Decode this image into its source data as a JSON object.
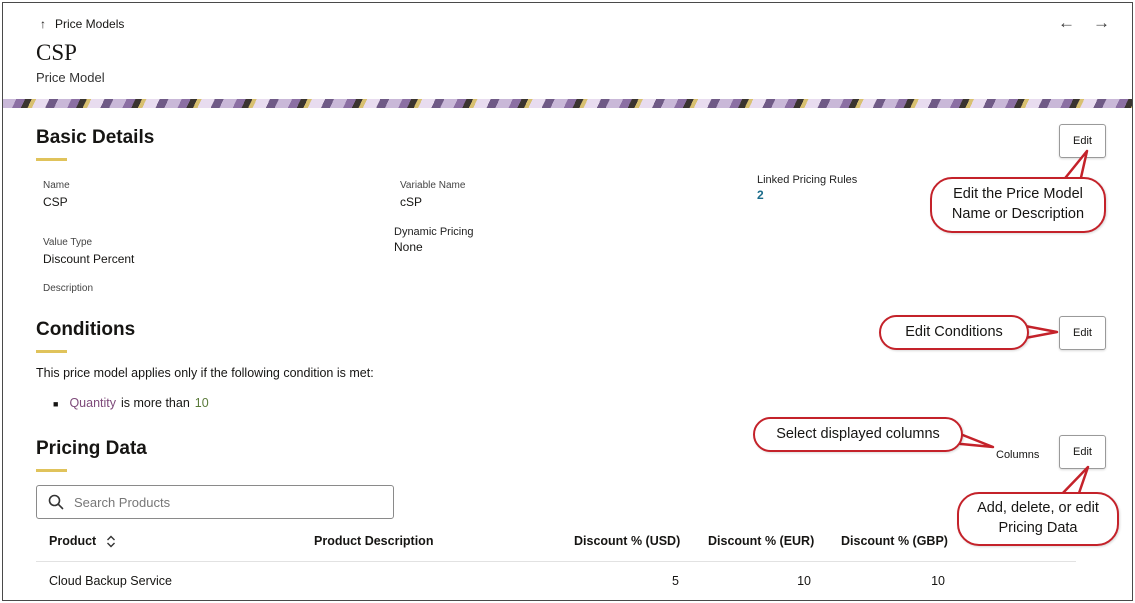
{
  "header": {
    "breadcrumb": "Price Models",
    "title": "CSP",
    "subtitle": "Price Model"
  },
  "basic_details": {
    "title": "Basic Details",
    "edit_label": "Edit",
    "name_label": "Name",
    "name_value": "CSP",
    "variable_name_label": "Variable Name",
    "variable_name_value": "cSP",
    "linked_rules_label": "Linked Pricing Rules",
    "linked_rules_value": "2",
    "value_type_label": "Value Type",
    "value_type_value": "Discount Percent",
    "dynamic_pricing_label": "Dynamic Pricing",
    "dynamic_pricing_value": "None",
    "description_label": "Description"
  },
  "conditions": {
    "title": "Conditions",
    "edit_label": "Edit",
    "intro": "This price model applies only if the following condition is met:",
    "item_attribute": "Quantity",
    "item_operator": "is more than",
    "item_value": "10"
  },
  "pricing_data": {
    "title": "Pricing Data",
    "columns_label": "Columns",
    "edit_label": "Edit",
    "search_placeholder": "Search Products",
    "headers": [
      "Product",
      "Product Description",
      "Discount % (USD)",
      "Discount % (EUR)",
      "Discount % (GBP)"
    ],
    "rows": [
      [
        "Cloud Backup Service",
        "",
        "5",
        "10",
        "10"
      ]
    ]
  },
  "callouts": {
    "basic_edit": "Edit the Price Model Name or Description",
    "conditions_edit": "Edit Conditions",
    "columns": "Select displayed columns",
    "pricing_edit": "Add, delete, or edit Pricing Data"
  },
  "colors": {
    "accent_underline": "#e0c35b",
    "callout_border": "#c4222a",
    "link": "#1a6b8a"
  }
}
